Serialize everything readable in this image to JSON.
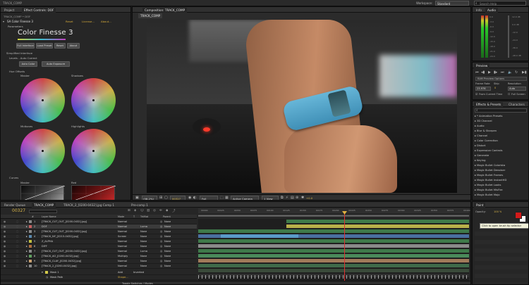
{
  "menu": {
    "title": "TRACK_COMP",
    "workspace_label": "Workspace:",
    "workspace_value": "Standard",
    "search_placeholder": "Search Help"
  },
  "effect_controls": {
    "tabs": [
      "Project",
      "Effect Controls: DOF"
    ],
    "breadcrumb": "TRACK_COMP • DOF",
    "effect_name": "SA Color Finesse 3",
    "effect_links": [
      "Reset",
      "License...",
      "About..."
    ],
    "parameters_label": "Parameters",
    "logo_text": "Color Finesse 3",
    "buttons": [
      "Full Interface",
      "Load Preset",
      "Reset",
      "About"
    ],
    "simplified_label": "Simplified Interface",
    "levels_label": "Levels - Auto Correct",
    "auto_buttons": [
      "Auto Color",
      "Auto Exposure"
    ],
    "hue_label": "Hue Offsets",
    "wheels": [
      "Master",
      "Shadows",
      "Midtones",
      "Highlights"
    ],
    "curves_label": "Curves",
    "curve_labels": [
      "Master",
      "Red"
    ]
  },
  "composition": {
    "tab": "Composition: TRACK_COMP",
    "subtab": "TRACK_COMP",
    "zoom": "(58.2%)",
    "timecode": "00327",
    "resolution": "Full",
    "camera": "Active Camera",
    "view": "1 View",
    "plus_value": "+0.0"
  },
  "info_panel": {
    "tabs": [
      "Info",
      "Audio"
    ],
    "db_labels": [
      "0.0",
      "-3.0",
      "-6.0",
      "-9.0",
      "-12.0",
      "-15.0",
      "-18.0",
      "-21.0",
      "-24.0"
    ],
    "db_right": [
      "12.0 dB",
      "0.0 dB",
      "-12.0",
      "-24.0",
      "-36.0",
      "-48.0 dB"
    ]
  },
  "preview_panel": {
    "tab": "Preview",
    "ram_label": "RAM Preview Options",
    "frame_rate_label": "Frame Rate",
    "skip_label": "Skip",
    "resolution_label": "Resolution",
    "frame_rate_value": "23.976",
    "skip_value": "0",
    "resolution_value": "Auto",
    "from_current": "From Current Time",
    "full_screen": "Full Screen"
  },
  "effects_presets": {
    "tabs": [
      "Effects & Presets",
      "Characters"
    ],
    "search_placeholder": "",
    "items": [
      "* Animation Presets",
      "3D Channel",
      "Audio",
      "Blur & Sharpen",
      "Channel",
      "Color Correction",
      "Distort",
      "Expression Controls",
      "Generate",
      "Keying",
      "Magic Bullet Colorista",
      "Magic Bullet Denoiser",
      "Magic Bullet Frames",
      "Magic Bullet InstantHD",
      "Magic Bullet Looks",
      "Magic Bullet MisFire",
      "Magic Bullet Mojo"
    ]
  },
  "timeline": {
    "tabs": [
      "Render Queue",
      "TRACK_COMP",
      "TRACK_2_[0200-0432].jpg Comp 1",
      "Pre-comp 1"
    ],
    "timecode": "00327",
    "header": [
      "#",
      "Layer Name",
      "Mode",
      "T",
      "TrkMat",
      "Parent"
    ],
    "ruler": [
      "00000",
      "00025",
      "00050",
      "00075",
      "00100",
      "00125",
      "00150",
      "00175",
      "00200",
      "00225",
      "00250",
      "00275",
      "00300",
      "00325",
      "00350",
      "00375",
      "00400"
    ],
    "layers": [
      {
        "num": "1",
        "name": "[TRACK_CUT_OUT_[0200-0432].jpg]",
        "mode": "Normal",
        "trkmat": "",
        "parent": "None"
      },
      {
        "num": "2",
        "name": "DOF",
        "mode": "Normal",
        "trkmat": "Luma",
        "parent": "None"
      },
      {
        "num": "3",
        "name": "[TRACK_CUT_OUT_[0200-0432].jpg]",
        "mode": "Normal",
        "trkmat": "None",
        "parent": "None"
      },
      {
        "num": "4",
        "name": "[TRACK_NY_[0215-0432].jpg]",
        "mode": "Screen",
        "trkmat": "None",
        "parent": "None"
      },
      {
        "num": "5",
        "name": "Z_ALPHA",
        "mode": "Normal",
        "trkmat": "None",
        "parent": "None"
      },
      {
        "num": "6",
        "name": "DIFF",
        "mode": "Normal",
        "trkmat": "None",
        "parent": "None"
      },
      {
        "num": "7",
        "name": "[TRACK_CUT_OUT_[0200-0432].jpg]",
        "mode": "Normal",
        "trkmat": "Luma",
        "parent": "None"
      },
      {
        "num": "8",
        "name": "[TRACK_AO_[0200-0432].jpg]",
        "mode": "Multiply",
        "trkmat": "None",
        "parent": "None"
      },
      {
        "num": "9",
        "name": "[TRACK_CLAY_[0200-0432].jpg]",
        "mode": "Normal",
        "trkmat": "None",
        "parent": "None"
      },
      {
        "num": "10",
        "name": "[TRACK_2_[0200-0432].jpg]",
        "mode": "Normal",
        "trkmat": "None",
        "parent": "None"
      }
    ],
    "mask_label": "Mask 1",
    "mask_mode": "Add",
    "mask_inverted": "Inverted",
    "mask_path": "Mask Path",
    "mask_shape": "Shape...",
    "toggle_label": "Toggle Switches / Modes"
  },
  "paint_panel": {
    "tab": "Paint",
    "tooltip": "Click to open brush tip selector",
    "opacity_label": "Opacity:",
    "opacity_value": "100 %",
    "colors": {
      "fg": "#d21a1a",
      "bg": "#ffffff"
    }
  }
}
